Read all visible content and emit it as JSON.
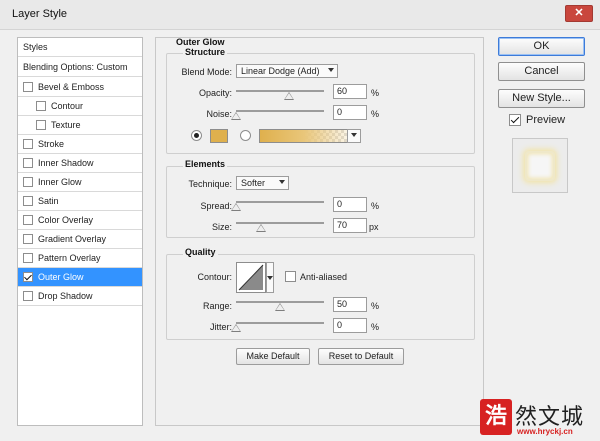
{
  "window": {
    "title": "Layer Style",
    "close_label": "✕"
  },
  "styles_list": {
    "header": "Styles",
    "blending": "Blending Options: Custom",
    "items": [
      {
        "label": "Bevel & Emboss",
        "checked": false
      },
      {
        "label": "Contour",
        "checked": false
      },
      {
        "label": "Texture",
        "checked": false
      },
      {
        "label": "Stroke",
        "checked": false
      },
      {
        "label": "Inner Shadow",
        "checked": false
      },
      {
        "label": "Inner Glow",
        "checked": false
      },
      {
        "label": "Satin",
        "checked": false
      },
      {
        "label": "Color Overlay",
        "checked": false
      },
      {
        "label": "Gradient Overlay",
        "checked": false
      },
      {
        "label": "Pattern Overlay",
        "checked": false
      },
      {
        "label": "Outer Glow",
        "checked": true
      },
      {
        "label": "Drop Shadow",
        "checked": false
      }
    ]
  },
  "outer_glow": {
    "title": "Outer Glow",
    "structure": {
      "title": "Structure",
      "blend_mode_label": "Blend Mode:",
      "blend_mode_value": "Linear Dodge (Add)",
      "opacity_label": "Opacity:",
      "opacity_value": "60",
      "opacity_fraction": 0.6,
      "noise_label": "Noise:",
      "noise_value": "0",
      "noise_fraction": 0.0,
      "percent": "%",
      "color_swatch": "#dfb04d"
    },
    "elements": {
      "title": "Elements",
      "technique_label": "Technique:",
      "technique_value": "Softer",
      "spread_label": "Spread:",
      "spread_value": "0",
      "spread_fraction": 0.0,
      "size_label": "Size:",
      "size_value": "70",
      "size_fraction": 0.28,
      "percent": "%",
      "px": "px"
    },
    "quality": {
      "title": "Quality",
      "contour_label": "Contour:",
      "anti_aliased_label": "Anti-aliased",
      "range_label": "Range:",
      "range_value": "50",
      "range_fraction": 0.5,
      "jitter_label": "Jitter:",
      "jitter_value": "0",
      "jitter_fraction": 0.0,
      "percent": "%"
    },
    "make_default": "Make Default",
    "reset_default": "Reset to Default"
  },
  "buttons": {
    "ok": "OK",
    "cancel": "Cancel",
    "new_style": "New Style...",
    "preview": "Preview"
  },
  "watermark": {
    "logo_char": "浩",
    "text": "然文城",
    "url": "www.hryckj.cn"
  }
}
